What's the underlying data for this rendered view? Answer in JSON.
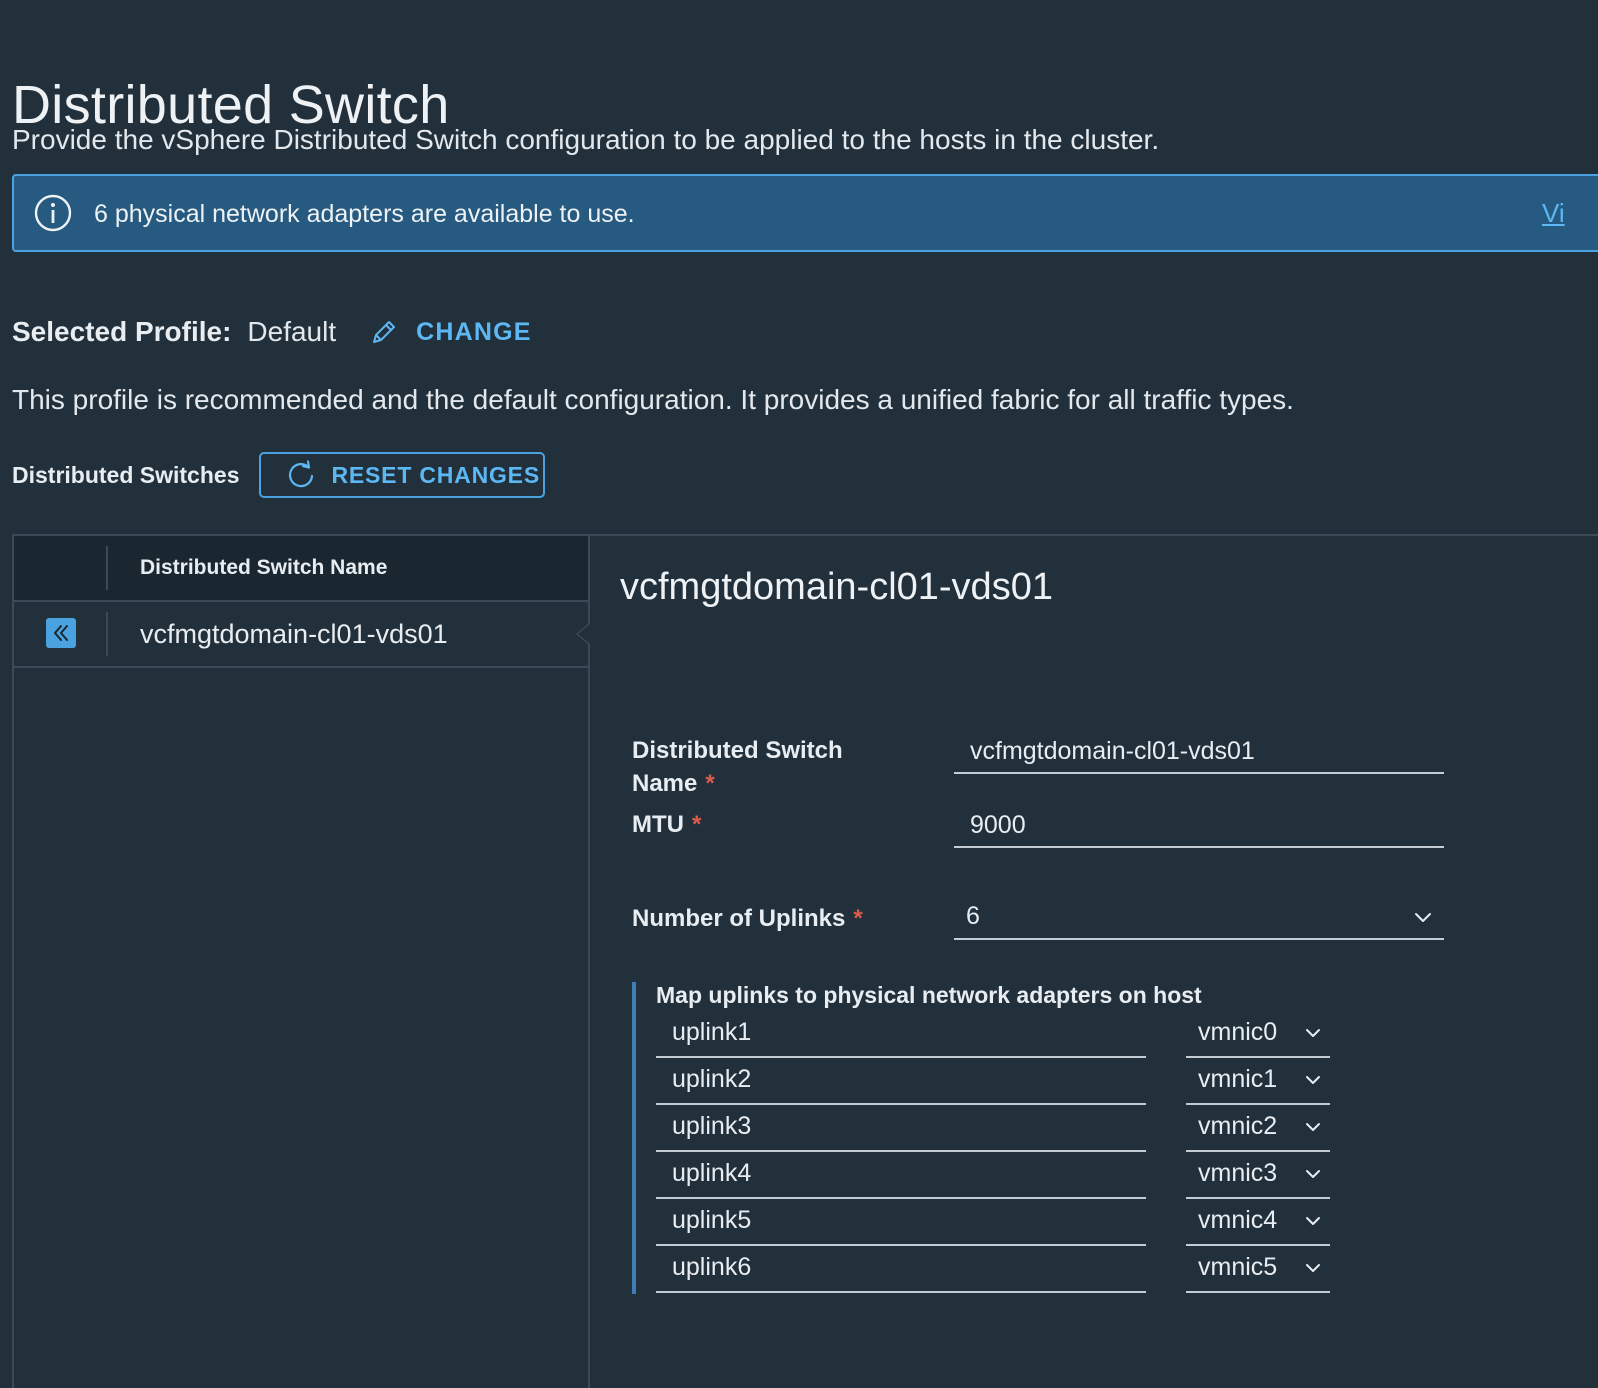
{
  "page": {
    "title": "Distributed Switch",
    "subtitle": "Provide the vSphere Distributed Switch configuration to be applied to the hosts in the cluster."
  },
  "banner": {
    "message": "6 physical network adapters are available to use.",
    "link_text": "Vi",
    "icon": "info-icon",
    "color": "#265a80"
  },
  "profile": {
    "label": "Selected Profile:",
    "value": "Default",
    "change_label": "CHANGE",
    "description": "This profile is recommended and the default configuration. It provides a unified fabric for all traffic types."
  },
  "switches": {
    "label": "Distributed Switches",
    "reset_label": "RESET CHANGES",
    "grid": {
      "column_header": "Distributed Switch Name",
      "rows": [
        {
          "name": "vcfmgtdomain-cl01-vds01"
        }
      ]
    }
  },
  "detail": {
    "title": "vcfmgtdomain-cl01-vds01",
    "fields": {
      "name_label_line1": "Distributed Switch",
      "name_label_line2": "Name",
      "name_value": "vcfmgtdomain-cl01-vds01",
      "mtu_label": "MTU",
      "mtu_value": "9000",
      "uplinks_label": "Number of Uplinks",
      "uplinks_value": "6",
      "required_mark": "*"
    },
    "mapping": {
      "title": "Map uplinks to physical network adapters on host",
      "rows": [
        {
          "uplink": "uplink1",
          "nic": "vmnic0"
        },
        {
          "uplink": "uplink2",
          "nic": "vmnic1"
        },
        {
          "uplink": "uplink3",
          "nic": "vmnic2"
        },
        {
          "uplink": "uplink4",
          "nic": "vmnic3"
        },
        {
          "uplink": "uplink5",
          "nic": "vmnic4"
        },
        {
          "uplink": "uplink6",
          "nic": "vmnic5"
        }
      ]
    }
  },
  "colors": {
    "background": "#22303b",
    "accent": "#5cb7f3",
    "required": "#e05a4d"
  }
}
